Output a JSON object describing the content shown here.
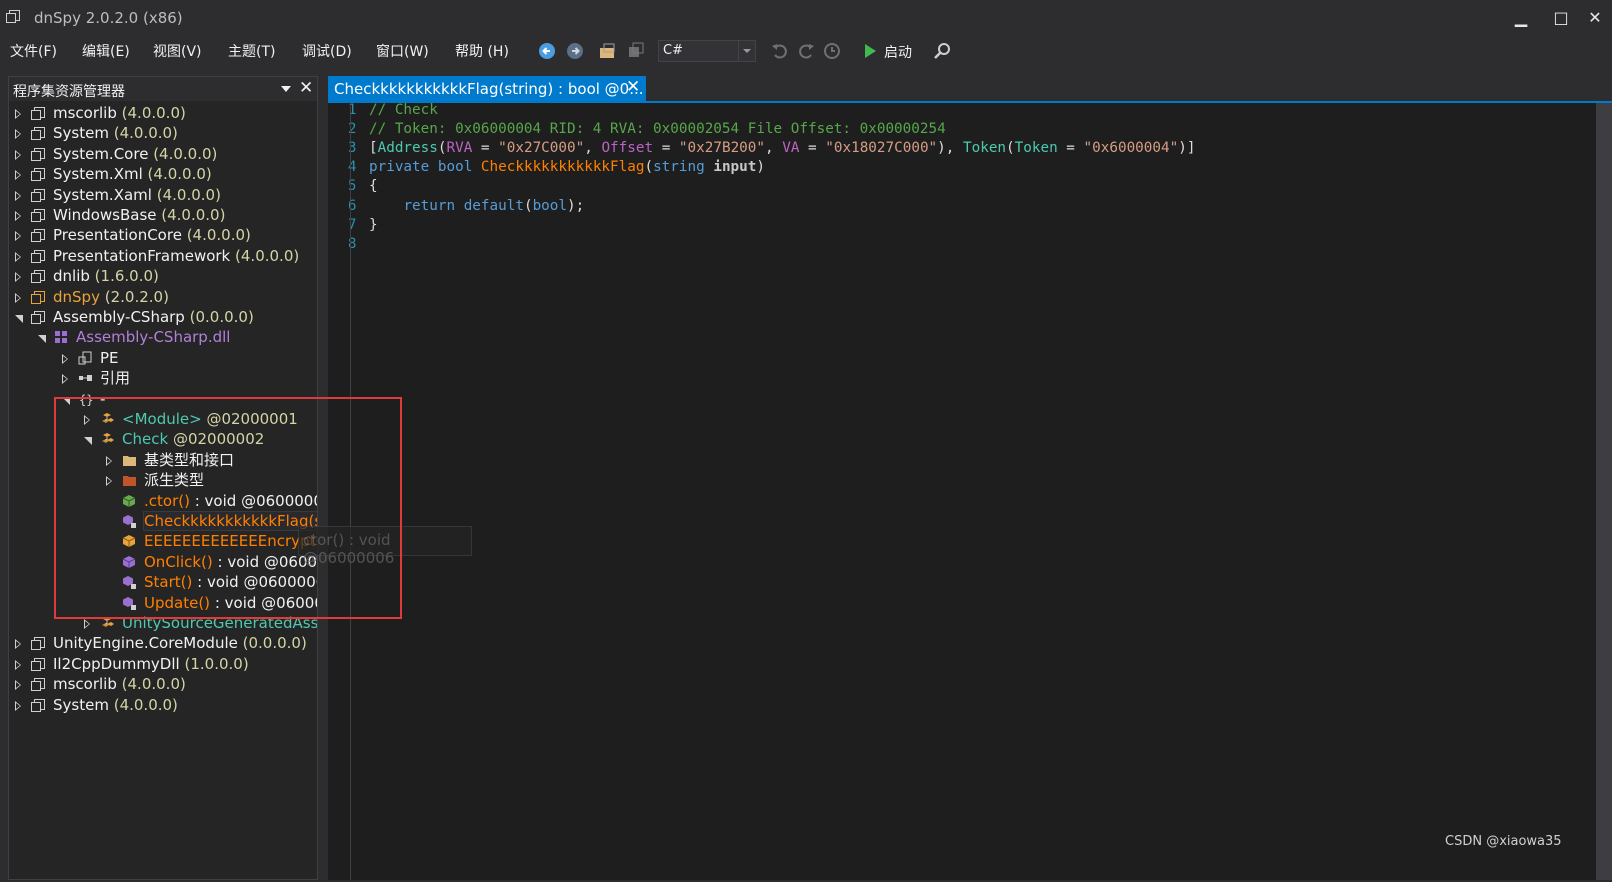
{
  "window": {
    "title": "dnSpy 2.0.2.0 (x86)",
    "minimize": "▁",
    "maximize": "□",
    "close": "✕"
  },
  "menu": [
    "文件(F)",
    "编辑(E)",
    "视图(V)",
    "主题(T)",
    "调试(D)",
    "窗口(W)",
    "帮助 (H)"
  ],
  "toolbar": {
    "language": "C#",
    "start_label": "启动"
  },
  "explorer": {
    "title": "程序集资源管理器",
    "close": "✕",
    "nodes": [
      {
        "name": "mscorlib",
        "ver": "(4.0.0.0)"
      },
      {
        "name": "System",
        "ver": "(4.0.0.0)"
      },
      {
        "name": "System.Core",
        "ver": "(4.0.0.0)"
      },
      {
        "name": "System.Xml",
        "ver": "(4.0.0.0)"
      },
      {
        "name": "System.Xaml",
        "ver": "(4.0.0.0)"
      },
      {
        "name": "WindowsBase",
        "ver": "(4.0.0.0)"
      },
      {
        "name": "PresentationCore",
        "ver": "(4.0.0.0)"
      },
      {
        "name": "PresentationFramework",
        "ver": "(4.0.0.0)"
      },
      {
        "name": "dnlib",
        "ver": "(1.6.0.0)"
      },
      {
        "name": "dnSpy",
        "ver": "(2.0.2.0)"
      },
      {
        "name": "Assembly-CSharp",
        "ver": "(0.0.0.0)"
      },
      {
        "name": "Assembly-CSharp.dll",
        "ver": ""
      },
      {
        "name": "PE",
        "ver": ""
      },
      {
        "name": "引用",
        "ver": ""
      },
      {
        "name": "-",
        "ver": ""
      },
      {
        "name": "<Module>",
        "ver": "@02000001"
      },
      {
        "name": "Check",
        "ver": "@02000002"
      },
      {
        "name": "基类型和接口",
        "ver": ""
      },
      {
        "name": "派生类型",
        "ver": ""
      },
      {
        "name": ".ctor()",
        "ver": " : void @0600000"
      },
      {
        "name": "CheckkkkkkkkkkkFlag(st",
        "ver": ""
      },
      {
        "name": "EEEEEEEEEEEEEncrypt(s",
        "ver": ""
      },
      {
        "name": "OnClick()",
        "ver": " : void @0600"
      },
      {
        "name": "Start()",
        "ver": " : void @0600000"
      },
      {
        "name": "Update()",
        "ver": " : void @06000"
      },
      {
        "name": "UnitySourceGeneratedAsse",
        "ver": ""
      },
      {
        "name": "UnityEngine.CoreModule",
        "ver": "(0.0.0.0)"
      },
      {
        "name": "Il2CppDummyDll",
        "ver": "(1.0.0.0)"
      },
      {
        "name": "mscorlib",
        "ver": "(4.0.0.0)"
      },
      {
        "name": "System",
        "ver": "(4.0.0.0)"
      }
    ],
    "tooltip": "ctor() : void @06000006"
  },
  "editor": {
    "tab_label": "CheckkkkkkkkkkkFlag(string) : bool @0...",
    "tab_close": "✕",
    "line_numbers": [
      "1",
      "2",
      "3",
      "4",
      "5",
      "6",
      "7",
      "8"
    ],
    "lines": [
      "// Check",
      "// Token: 0x06000004 RID: 4 RVA: 0x00002054 File Offset: 0x00000254",
      "[Address(RVA = \"0x27C000\", Offset = \"0x27B200\", VA = \"0x18027C000\"), Token(Token = \"0x6000004\")]",
      "private bool CheckkkkkkkkkkkFlag(string input)",
      "{",
      "    return default(bool);",
      "}",
      ""
    ]
  },
  "watermark": "CSDN @xiaowa35",
  "colors": {
    "accent": "#007acc",
    "highlight_box": "#e03a3a",
    "method_orange": "#ff8000",
    "type_teal": "#4ec9b0"
  }
}
